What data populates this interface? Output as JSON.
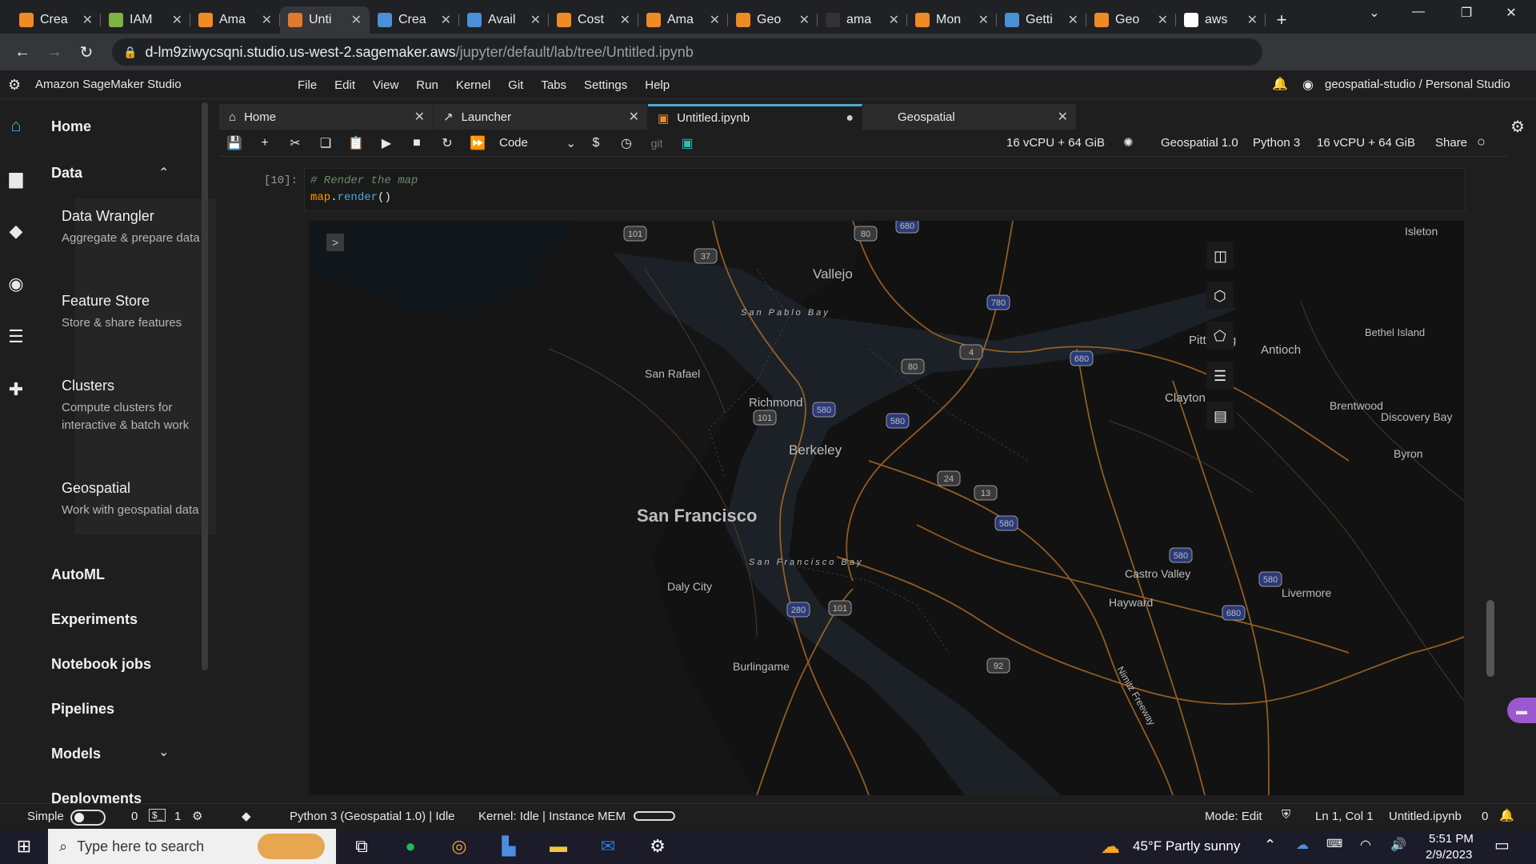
{
  "browser": {
    "tabs": [
      {
        "label": "Crea",
        "color": "#f08a24"
      },
      {
        "label": "IAM",
        "color": "#7cb342"
      },
      {
        "label": "Ama",
        "color": "#f08a24"
      },
      {
        "label": "Unti",
        "color": "#e07a2e",
        "active": true
      },
      {
        "label": "Crea",
        "color": "#4a90d9"
      },
      {
        "label": "Avail",
        "color": "#4a90d9"
      },
      {
        "label": "Cost",
        "color": "#f08a24"
      },
      {
        "label": "Ama",
        "color": "#f08a24"
      },
      {
        "label": "Geo",
        "color": "#f08a24"
      },
      {
        "label": "ama",
        "color": "#333333"
      },
      {
        "label": "Mon",
        "color": "#f08a24"
      },
      {
        "label": "Getti",
        "color": "#4a90d9"
      },
      {
        "label": "Geo",
        "color": "#f08a24"
      },
      {
        "label": "aws",
        "color": "#ffffff"
      }
    ],
    "new_tab": "+",
    "url_host": "d-lm9ziwycsqni.studio.us-west-2.sagemaker.aws",
    "url_path": "/jupyter/default/lab/tree/Untitled.ipynb"
  },
  "studio": {
    "title": "Amazon SageMaker Studio",
    "menu": [
      "File",
      "Edit",
      "View",
      "Run",
      "Kernel",
      "Git",
      "Tabs",
      "Settings",
      "Help"
    ],
    "user": "geospatial-studio / Personal Studio"
  },
  "sidebar": {
    "home": "Home",
    "data": "Data",
    "data_items": [
      {
        "title": "Data Wrangler",
        "desc": "Aggregate & prepare data"
      },
      {
        "title": "Feature Store",
        "desc": "Store & share features"
      },
      {
        "title": "Clusters",
        "desc": "Compute clusters for interactive & batch work"
      },
      {
        "title": "Geospatial",
        "desc": "Work with geospatial data"
      }
    ],
    "automl": "AutoML",
    "experiments": "Experiments",
    "notebook_jobs": "Notebook jobs",
    "pipelines": "Pipelines",
    "models": "Models",
    "deployments": "Deployments"
  },
  "doc_tabs": [
    {
      "label": "Home",
      "icon": "home-icon"
    },
    {
      "label": "Launcher",
      "icon": "launcher-icon"
    },
    {
      "label": "Untitled.ipynb",
      "icon": "notebook-icon",
      "active": true
    },
    {
      "label": "Geospatial",
      "icon": ""
    }
  ],
  "toolbar": {
    "cell_type": "Code",
    "git": "git",
    "instance": "16 vCPU + 64 GiB",
    "image": "Geospatial 1.0",
    "kernel": "Python 3",
    "instance2": "16 vCPU + 64 GiB",
    "share": "Share"
  },
  "cell": {
    "prompt": "[10]:",
    "comment": "# Render the map",
    "code_obj": "map",
    "code_dot": ".",
    "code_fn": "render",
    "code_paren": "()"
  },
  "map": {
    "expand": ">",
    "cities": [
      {
        "name": "Isleton"
      },
      {
        "name": "Vallejo"
      },
      {
        "name": "Pittsburg"
      },
      {
        "name": "Antioch"
      },
      {
        "name": "Bethel Island"
      },
      {
        "name": "San Rafael"
      },
      {
        "name": "Richmond"
      },
      {
        "name": "Clayton"
      },
      {
        "name": "Brentwood"
      },
      {
        "name": "Discovery Bay"
      },
      {
        "name": "Berkeley"
      },
      {
        "name": "Byron"
      },
      {
        "name": "San Francisco"
      },
      {
        "name": "Castro Valley"
      },
      {
        "name": "Livermore"
      },
      {
        "name": "Daly City"
      },
      {
        "name": "Hayward"
      },
      {
        "name": "Burlingame"
      },
      {
        "name": "Nimitz Freeway"
      }
    ],
    "water": [
      "San Pablo Bay",
      "San Francisco Bay"
    ],
    "shields": [
      "101",
      "37",
      "80",
      "680",
      "780",
      "4",
      "680",
      "80",
      "580",
      "580",
      "101",
      "24",
      "13",
      "580",
      "580",
      "580",
      "680",
      "280",
      "101",
      "92"
    ]
  },
  "statusbar": {
    "mode_label": "Simple",
    "count_a": "0",
    "count_b": "1",
    "kernel_info": "Python 3 (Geospatial 1.0) | Idle",
    "kernel_status": "Kernel: Idle | Instance MEM",
    "mode": "Mode: Edit",
    "position": "Ln 1, Col 1",
    "file": "Untitled.ipynb",
    "notif_count": "0"
  },
  "taskbar": {
    "search_placeholder": "Type here to search",
    "weather": "45°F  Partly sunny",
    "time": "5:51 PM",
    "date": "2/9/2023"
  }
}
